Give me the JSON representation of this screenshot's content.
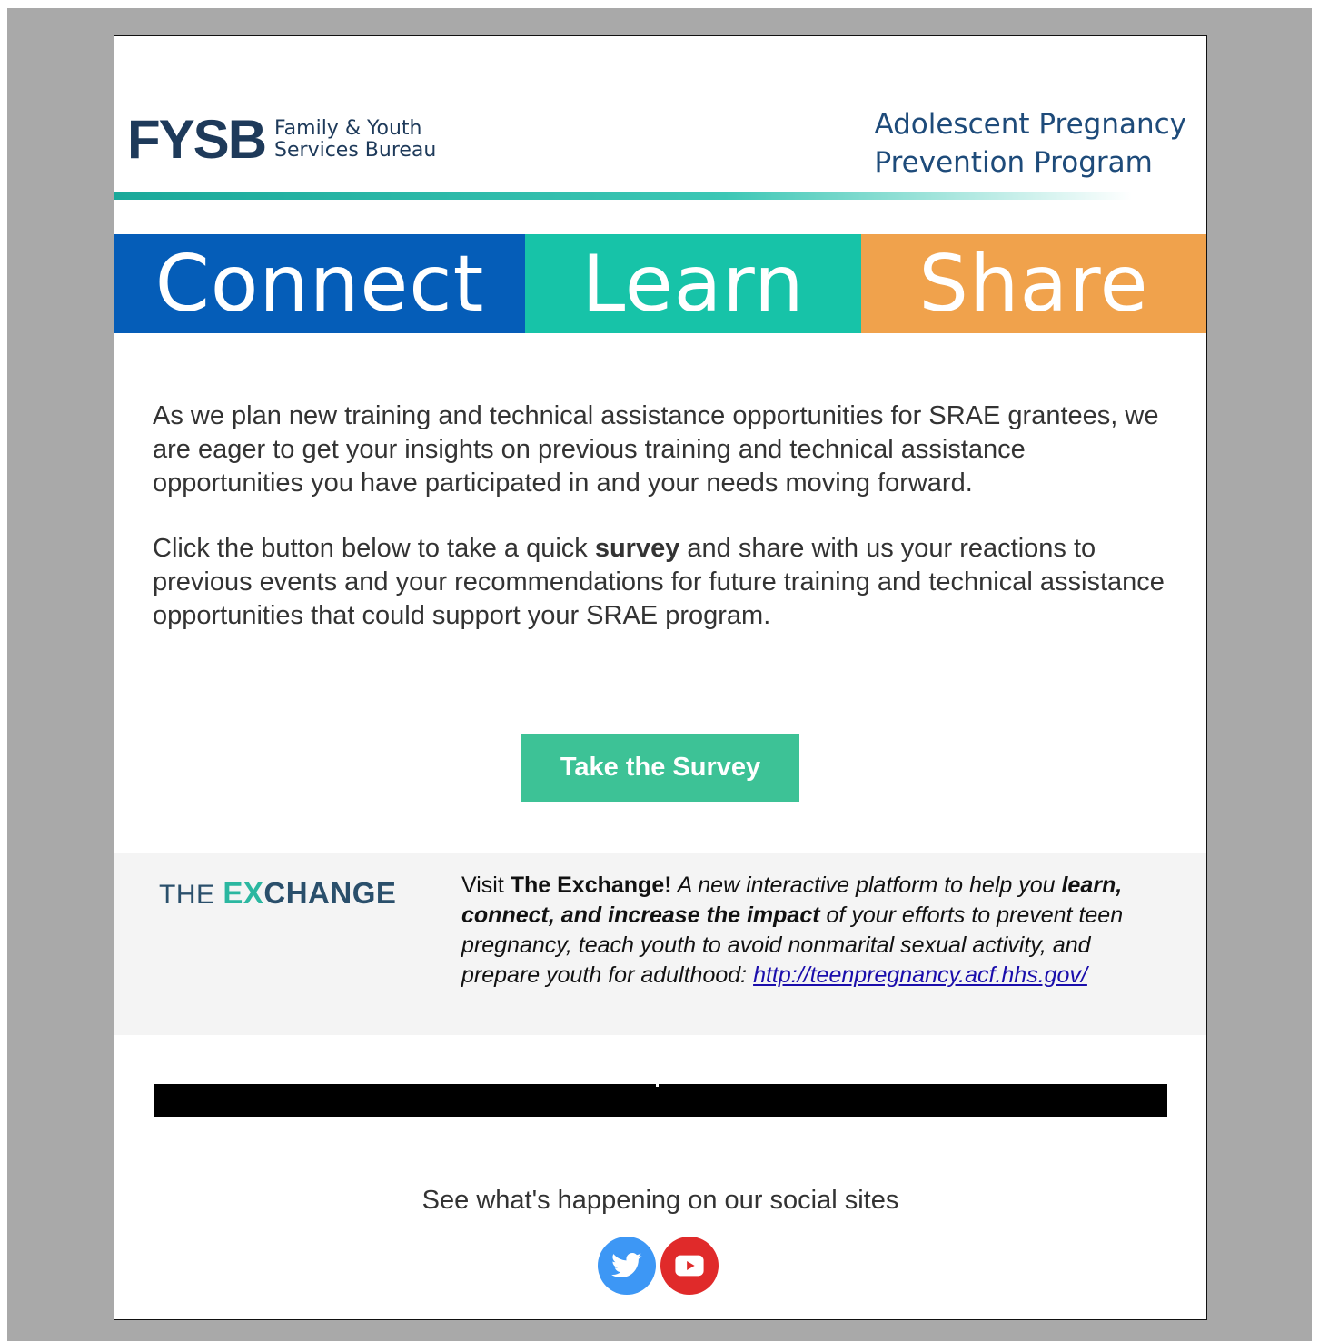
{
  "header": {
    "logo_mark": "FYSB",
    "logo_text_line1": "Family & Youth",
    "logo_text_line2": "Services Bureau",
    "program_line1": "Adolescent Pregnancy",
    "program_line2": "Prevention Program"
  },
  "banner": {
    "word1": "Connect",
    "word2": "Learn",
    "word3": "Share",
    "colors": [
      "#055db8",
      "#17c3a8",
      "#f0a24c"
    ]
  },
  "body": {
    "para1": "As we plan new training and technical assistance opportunities for SRAE grantees, we are eager to get your insights on previous training and technical assistance opportunities you have participated in and your needs moving forward.",
    "para2_before": "Click the button below to take a quick ",
    "para2_bold": "survey",
    "para2_after": " and share with us your reactions to previous events and your recommendations for future training and technical assistance opportunities that could support your SRAE program."
  },
  "cta": {
    "label": "Take the Survey",
    "color": "#3dc296"
  },
  "exchange": {
    "logo_the": "THE ",
    "logo_x": "EX",
    "logo_rest": "CHANGE",
    "visit": "Visit ",
    "name_bold": "The Exchange!",
    "italic1": " A new interactive platform to help you ",
    "italic_bold": "learn, connect, and increase the impact",
    "italic2": " of your efforts to prevent teen pregnancy, teach youth to avoid nonmarital sexual activity, and prepare youth for adulthood: ",
    "link": "http://teenpregnancy.acf.hhs.gov/"
  },
  "social": {
    "title": "See what's happening on our social sites",
    "icons": [
      "twitter-icon",
      "youtube-icon"
    ]
  }
}
